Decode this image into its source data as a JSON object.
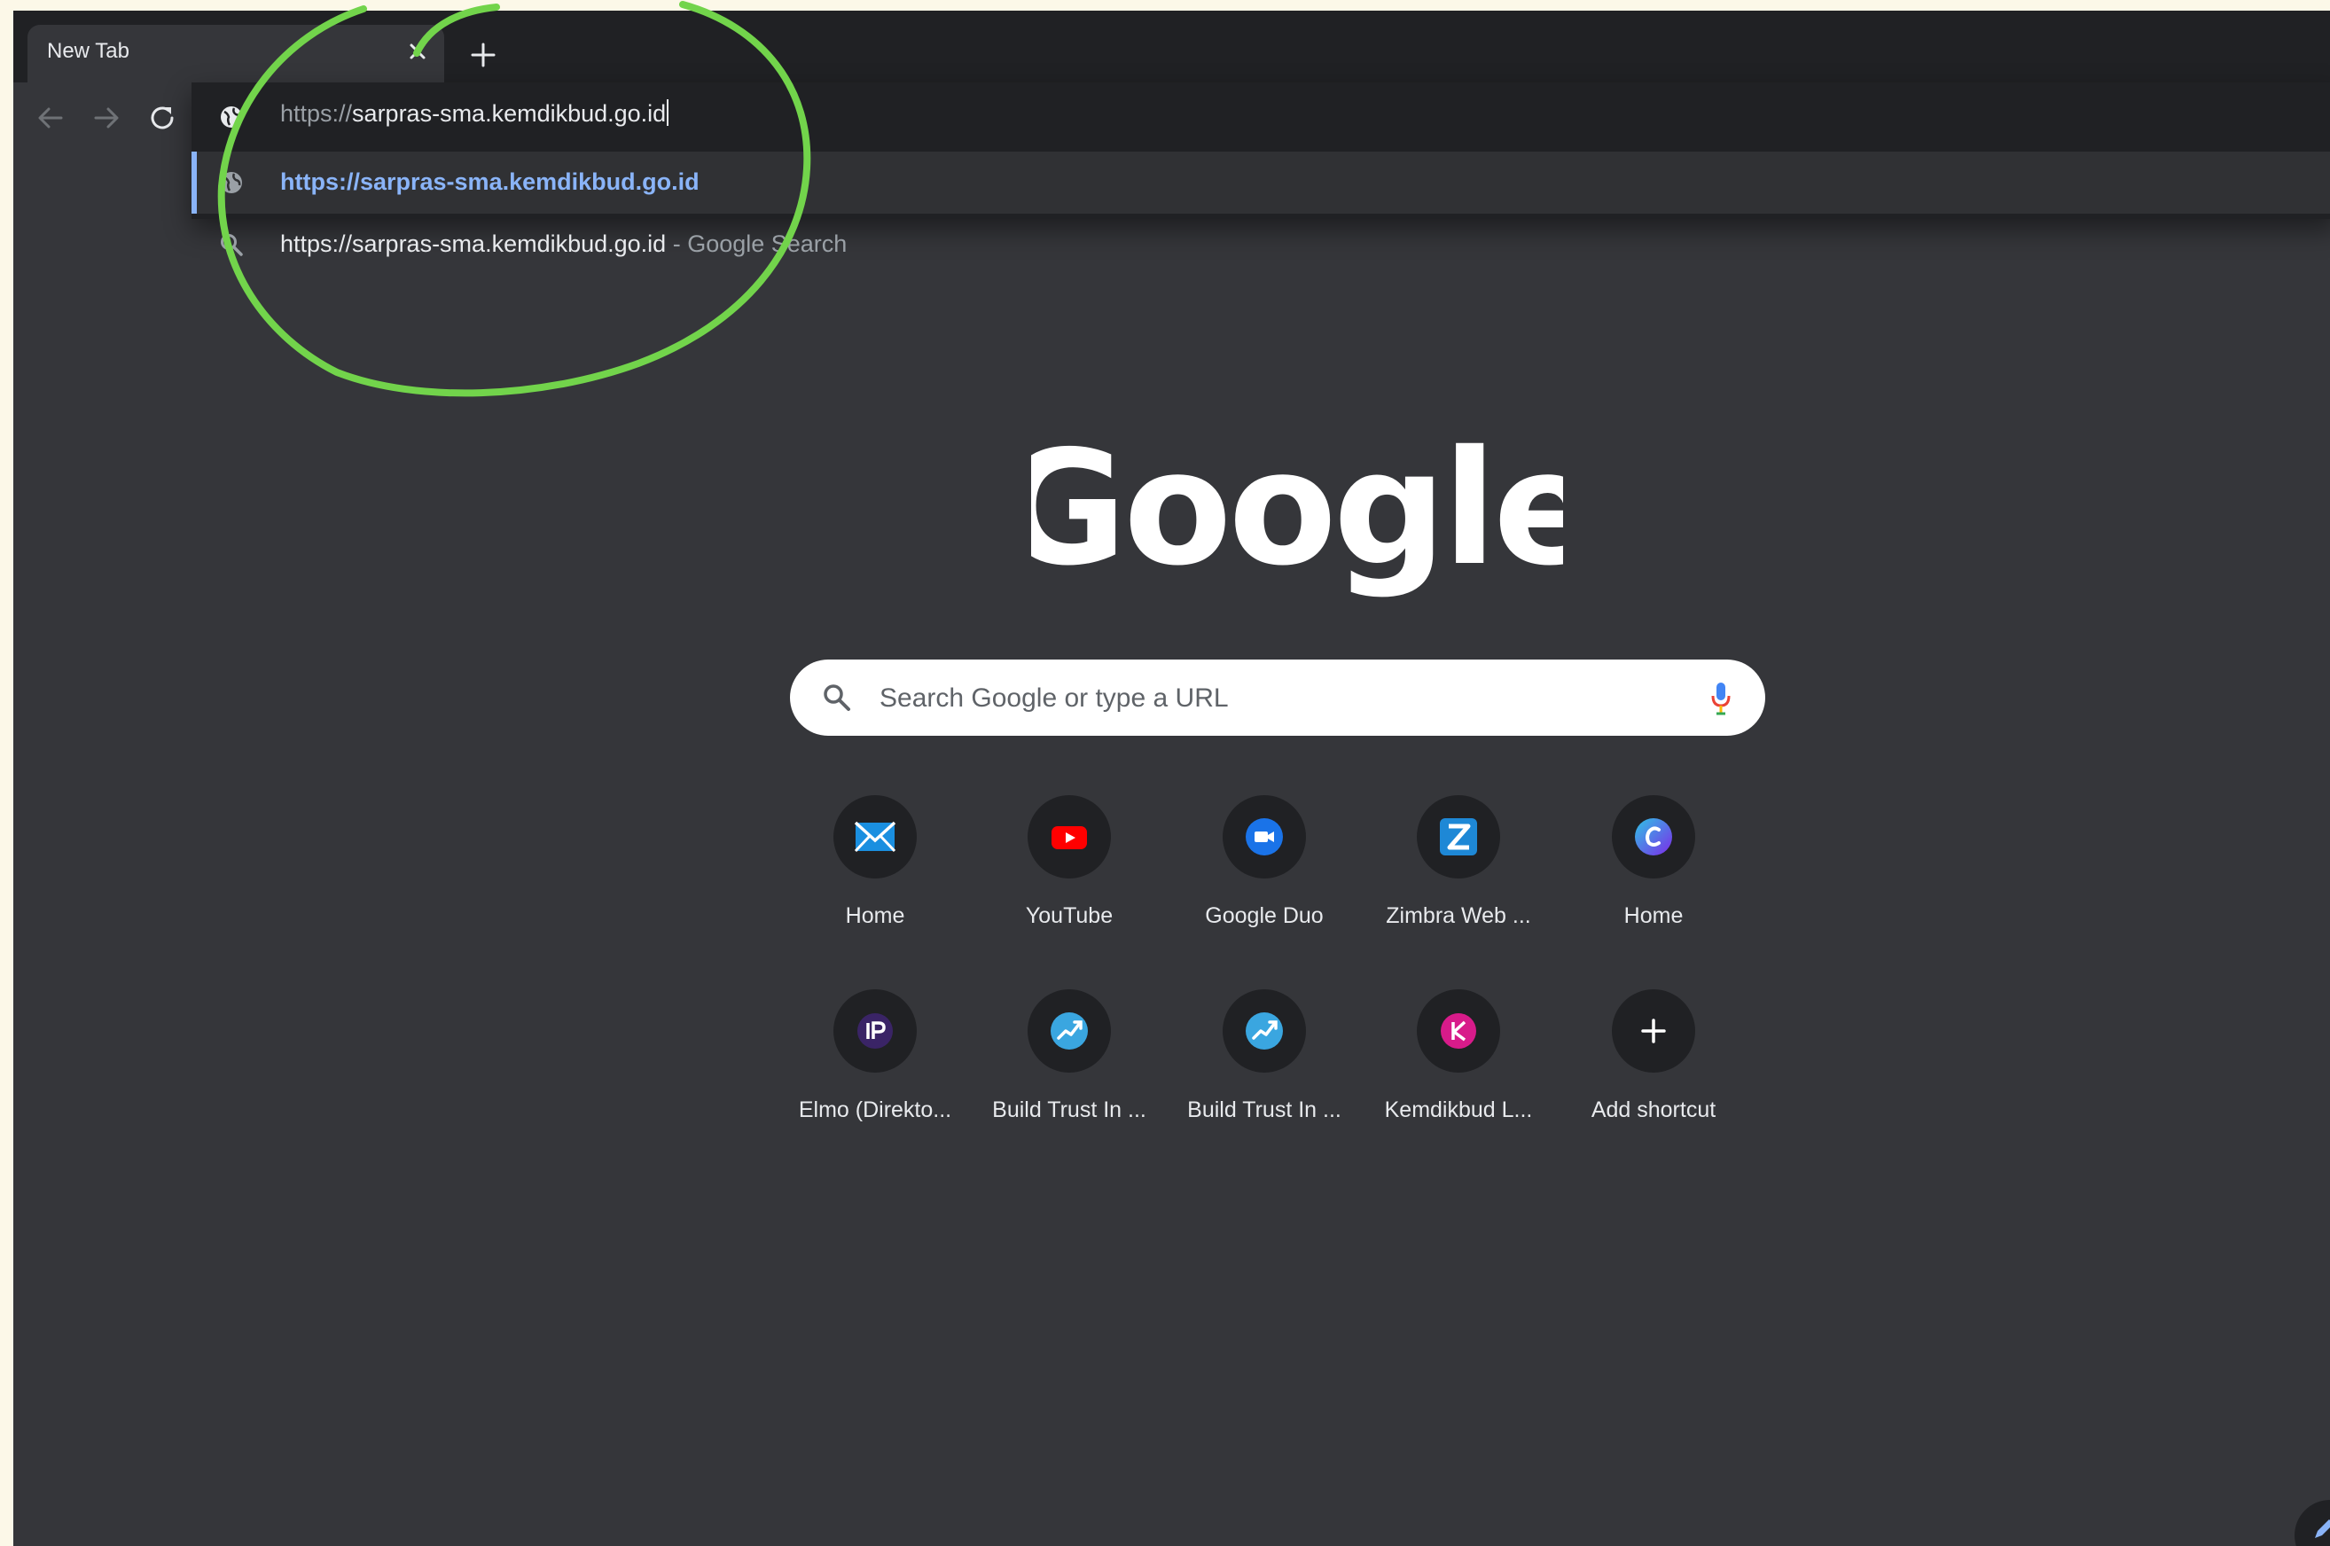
{
  "tab": {
    "title": "New Tab"
  },
  "omnibox": {
    "scheme": "https://",
    "host": "sarpras-sma.kemdikbud.go.id",
    "suggestions": [
      {
        "text": "https://sarpras-sma.kemdikbud.go.id",
        "suffix": "",
        "icon": "globe-icon"
      },
      {
        "text": "https://sarpras-sma.kemdikbud.go.id",
        "suffix": " - Google Search",
        "icon": "search-icon"
      }
    ]
  },
  "logo": {
    "text": "Google"
  },
  "search": {
    "placeholder": "Search Google or type a URL"
  },
  "shortcuts": [
    {
      "label": "Home",
      "icon": "mail-icon"
    },
    {
      "label": "YouTube",
      "icon": "youtube-icon"
    },
    {
      "label": "Google Duo",
      "icon": "duo-icon"
    },
    {
      "label": "Zimbra Web ...",
      "icon": "zimbra-icon"
    },
    {
      "label": "Home",
      "icon": "canva-icon"
    },
    {
      "label": "Elmo (Direkto...",
      "icon": "ip-icon"
    },
    {
      "label": "Build Trust In ...",
      "icon": "build-trust-icon"
    },
    {
      "label": "Build Trust In ...",
      "icon": "build-trust-icon"
    },
    {
      "label": "Kemdikbud L...",
      "icon": "k-icon"
    },
    {
      "label": "Add shortcut",
      "icon": "plus-icon"
    }
  ],
  "colors": {
    "highlight_ellipse": "#72d44b",
    "link": "#8ab4f8",
    "background": "#35363a"
  }
}
